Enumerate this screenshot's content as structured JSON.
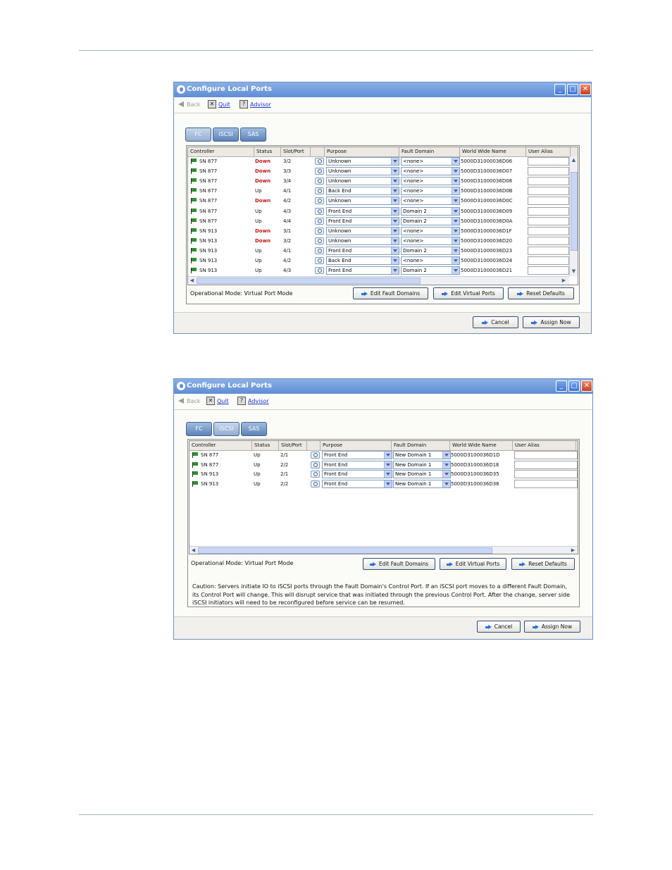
{
  "window1": {
    "title": "Configure Local Ports",
    "nav": {
      "back": "Back",
      "quit": "Quit",
      "advisor": "Advisor"
    },
    "tabs": [
      {
        "label": "FC",
        "selected": true
      },
      {
        "label": "iSCSI",
        "selected": false
      },
      {
        "label": "SAS",
        "selected": false
      }
    ],
    "columns": [
      "Controller",
      "Status",
      "Slot/Port",
      "Purpose",
      "Fault Domain",
      "World Wide Name",
      "User Alias"
    ],
    "rows": [
      {
        "controller": "SN 877",
        "status": "Down",
        "slot": "3/2",
        "purpose": "Unknown",
        "domain": "<none>",
        "wwn": "5000D31000036D06"
      },
      {
        "controller": "SN 877",
        "status": "Down",
        "slot": "3/3",
        "purpose": "Unknown",
        "domain": "<none>",
        "wwn": "5000D31000036D07"
      },
      {
        "controller": "SN 877",
        "status": "Down",
        "slot": "3/4",
        "purpose": "Unknown",
        "domain": "<none>",
        "wwn": "5000D31000036D08"
      },
      {
        "controller": "SN 877",
        "status": "Up",
        "slot": "4/1",
        "purpose": "Back End",
        "domain": "<none>",
        "wwn": "5000D31000036D0B"
      },
      {
        "controller": "SN 877",
        "status": "Down",
        "slot": "4/2",
        "purpose": "Unknown",
        "domain": "<none>",
        "wwn": "5000D31000036D0C"
      },
      {
        "controller": "SN 877",
        "status": "Up",
        "slot": "4/3",
        "purpose": "Front End",
        "domain": "Domain 2",
        "wwn": "5000D31000036D09"
      },
      {
        "controller": "SN 877",
        "status": "Up",
        "slot": "4/4",
        "purpose": "Front End",
        "domain": "Domain 2",
        "wwn": "5000D31000036D0A"
      },
      {
        "controller": "SN 913",
        "status": "Down",
        "slot": "3/1",
        "purpose": "Unknown",
        "domain": "<none>",
        "wwn": "5000D31000036D1F"
      },
      {
        "controller": "SN 913",
        "status": "Down",
        "slot": "3/2",
        "purpose": "Unknown",
        "domain": "<none>",
        "wwn": "5000D31000036D20"
      },
      {
        "controller": "SN 913",
        "status": "Up",
        "slot": "4/1",
        "purpose": "Front End",
        "domain": "Domain 2",
        "wwn": "5000D31000036D23"
      },
      {
        "controller": "SN 913",
        "status": "Up",
        "slot": "4/2",
        "purpose": "Back End",
        "domain": "<none>",
        "wwn": "5000D31000036D24"
      },
      {
        "controller": "SN 913",
        "status": "Up",
        "slot": "4/3",
        "purpose": "Front End",
        "domain": "Domain 2",
        "wwn": "5000D31000036D21"
      }
    ],
    "mode_label": "Operational Mode: Virtual Port Mode",
    "buttons": {
      "edit_fault": "Edit Fault Domains",
      "edit_virtual": "Edit Virtual Ports",
      "reset": "Reset Defaults",
      "cancel": "Cancel",
      "assign": "Assign Now"
    }
  },
  "window2": {
    "title": "Configure Local Ports",
    "nav": {
      "back": "Back",
      "quit": "Quit",
      "advisor": "Advisor"
    },
    "tabs": [
      {
        "label": "FC",
        "selected": false
      },
      {
        "label": "iSCSI",
        "selected": true
      },
      {
        "label": "SAS",
        "selected": false
      }
    ],
    "columns": [
      "Controller",
      "Status",
      "Slot/Port",
      "Purpose",
      "Fault Domain",
      "World Wide Name",
      "User Alias"
    ],
    "rows": [
      {
        "controller": "SN 877",
        "status": "Up",
        "slot": "2/1",
        "purpose": "Front End",
        "domain": "New Domain 1",
        "wwn": "5000D3100036D1D"
      },
      {
        "controller": "SN 877",
        "status": "Up",
        "slot": "2/2",
        "purpose": "Front End",
        "domain": "New Domain 1",
        "wwn": "5000D3100036D1E"
      },
      {
        "controller": "SN 913",
        "status": "Up",
        "slot": "2/1",
        "purpose": "Front End",
        "domain": "New Domain 1",
        "wwn": "5000D3100036D35"
      },
      {
        "controller": "SN 913",
        "status": "Up",
        "slot": "2/2",
        "purpose": "Front End",
        "domain": "New Domain 1",
        "wwn": "5000D3100036D36"
      }
    ],
    "mode_label": "Operational Mode: Virtual Port Mode",
    "caution": "Caution: Servers initiate IO to iSCSI ports through the Fault Domain's Control Port. If an iSCSI port moves to a different Fault Domain, its Control Port will change. This will disrupt service that was initiated through the previous Control Port. After the change, server side iSCSI initiators will need to be reconfigured before service can be resumed.",
    "buttons": {
      "edit_fault": "Edit Fault Domains",
      "edit_virtual": "Edit Virtual Ports",
      "reset": "Reset Defaults",
      "cancel": "Cancel",
      "assign": "Assign Now"
    }
  },
  "colors": {
    "titlebar": "#6f9ae0",
    "status_down": "#c41414",
    "link": "#1a35c8",
    "tab": "#6e91c4"
  }
}
